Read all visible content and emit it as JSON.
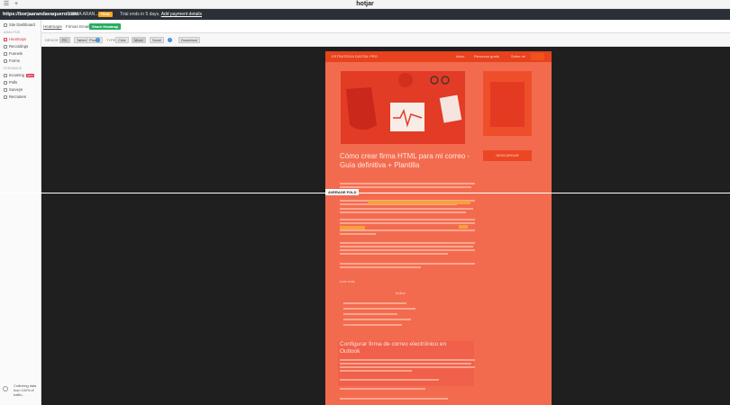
{
  "brand": "hotjar",
  "site": {
    "url": "https://borjaarandavaquero.com",
    "user": "BORJA ARAN...",
    "trial_badge": "TRIAL",
    "trial_text": "Trial ends in 5 days.",
    "payment_link": "Add payment details"
  },
  "breadcrumb": {
    "root": "Heatmaps",
    "current": "Firmas Email"
  },
  "share_label": "Share Heatmap",
  "toolbar": {
    "device_label": "DEVICE",
    "devices": [
      "PC",
      "Tablet",
      "Phone"
    ],
    "type_label": "TYPE",
    "types": [
      "Click",
      "Move",
      "Scroll"
    ],
    "download": "Download"
  },
  "sidebar": {
    "dashboard": "Site Dashboard",
    "analysis_head": "ANALYSIS",
    "analysis": [
      "Heatmaps",
      "Recordings",
      "Funnels",
      "Forms"
    ],
    "feedback_head": "FEEDBACK",
    "feedback": [
      "Incoming",
      "Polls",
      "Surveys",
      "Recruiters"
    ],
    "new_badge": "NEW",
    "footer": "Collecting data from 100% of traffic..."
  },
  "heatmap": {
    "nav_logo": "ESTRATEGIA DIGITAL PRO",
    "nav_items": [
      "Inicio",
      "Recursos gratis",
      "Sobre mí"
    ],
    "headline": "Cómo crear firma HTML para mi correo - Guía definitiva + Plantilla",
    "side_cta": "DESCARGAR",
    "fold_label": "AVERAGE FOLD",
    "section_heading": "Configurar firma de correo electrónico en Outlook",
    "toc_title": "Índice",
    "read_more": "Leer más"
  },
  "colors": {
    "accent": "#e0354a",
    "share": "#27ae60",
    "heat": "#f36b4f",
    "topbar": "#2b2f36"
  }
}
